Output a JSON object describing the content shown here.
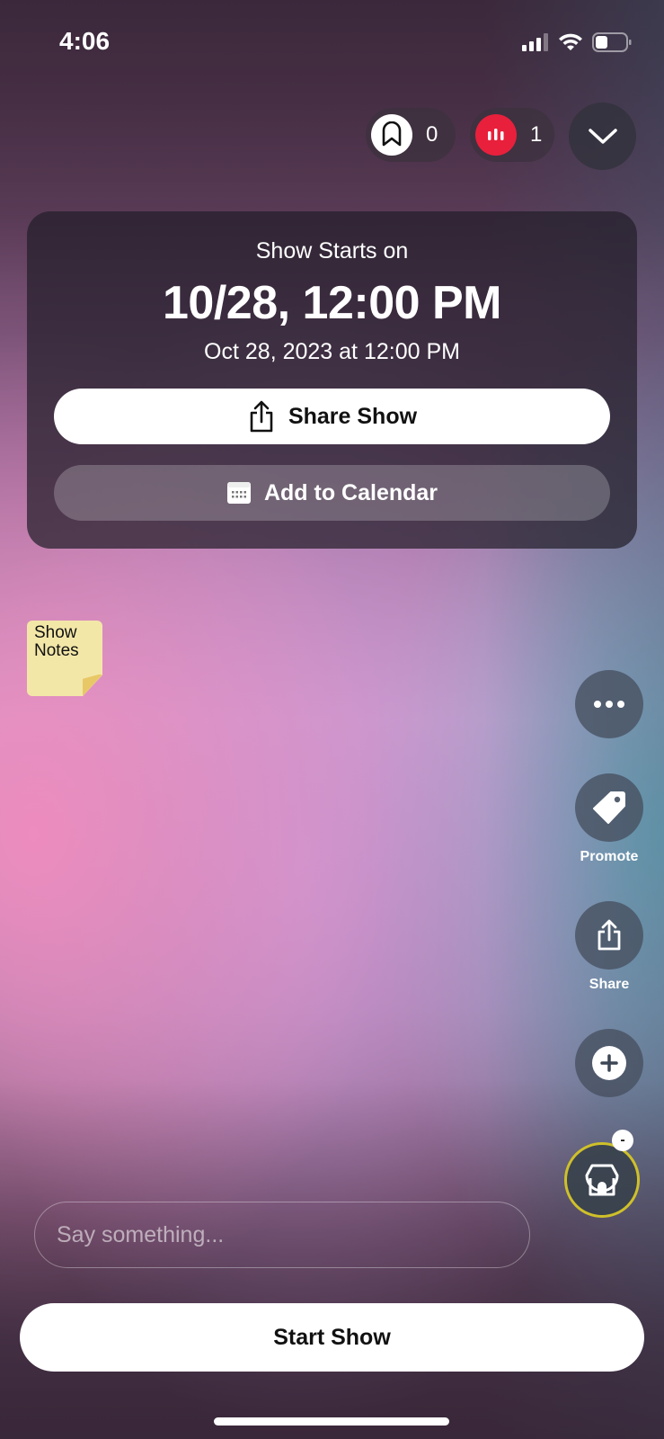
{
  "status_bar": {
    "time": "4:06",
    "icons": [
      "cellular-signal-icon",
      "wifi-icon",
      "battery-icon"
    ],
    "battery_level": 0.35
  },
  "top_controls": {
    "saved": {
      "icon": "bookmark-icon",
      "count": "0"
    },
    "viewers": {
      "icon": "live-bars-icon",
      "count": "1",
      "color": "#e8203c"
    },
    "collapse": {
      "icon": "chevron-down-icon"
    }
  },
  "schedule_card": {
    "label": "Show Starts on",
    "short_datetime": "10/28, 12:00 PM",
    "full_datetime": "Oct 28, 2023 at 12:00 PM",
    "share_button": {
      "label": "Share Show",
      "icon": "share-icon"
    },
    "calendar_button": {
      "label": "Add to Calendar",
      "icon": "calendar-icon"
    }
  },
  "show_notes": {
    "label_line1": "Show",
    "label_line2": "Notes",
    "color": "#f3e7a8"
  },
  "right_rail": {
    "more": {
      "icon": "more-dots-icon"
    },
    "promote": {
      "icon": "tag-icon",
      "label": "Promote"
    },
    "share": {
      "icon": "share-icon",
      "label": "Share"
    },
    "add": {
      "icon": "plus-circle-icon"
    },
    "shop": {
      "icon": "storefront-icon",
      "badge": "-",
      "ring_color": "#cfc02a"
    }
  },
  "comment_input": {
    "placeholder": "Say something...",
    "value": ""
  },
  "start_button": {
    "label": "Start Show"
  }
}
